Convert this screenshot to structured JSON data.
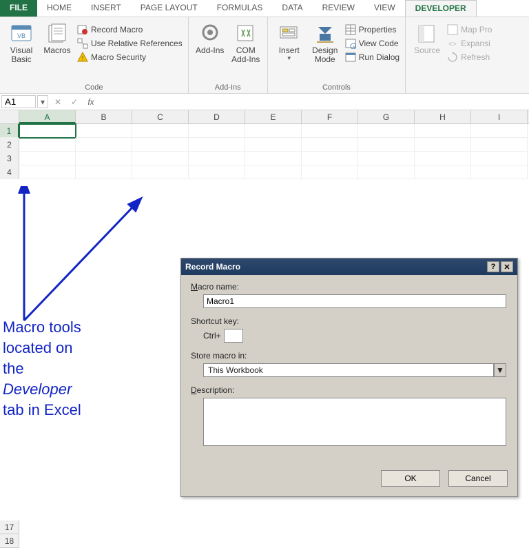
{
  "tabs": {
    "file": "FILE",
    "home": "HOME",
    "insert": "INSERT",
    "page_layout": "PAGE LAYOUT",
    "formulas": "FORMULAS",
    "data": "DATA",
    "review": "REVIEW",
    "view": "VIEW",
    "developer": "DEVELOPER"
  },
  "ribbon": {
    "code": {
      "visual_basic": "Visual\nBasic",
      "macros": "Macros",
      "record_macro": "Record Macro",
      "use_relative": "Use Relative References",
      "macro_security": "Macro Security",
      "label": "Code"
    },
    "addins": {
      "addins": "Add-Ins",
      "com_addins": "COM\nAdd-Ins",
      "label": "Add-Ins"
    },
    "controls": {
      "insert": "Insert",
      "design_mode": "Design\nMode",
      "properties": "Properties",
      "view_code": "View Code",
      "run_dialog": "Run Dialog",
      "label": "Controls"
    },
    "xml": {
      "source": "Source",
      "map_props": "Map Pro",
      "expansion": "Expansi",
      "refresh": "Refresh"
    }
  },
  "namebox": "A1",
  "columns": [
    "A",
    "B",
    "C",
    "D",
    "E",
    "F",
    "G",
    "H",
    "I"
  ],
  "rows_top": [
    "1",
    "2",
    "3",
    "4"
  ],
  "rows_bottom": [
    "17",
    "18"
  ],
  "dialog": {
    "title": "Record Macro",
    "macro_name_label_pre": "M",
    "macro_name_label_rest": "acro name:",
    "macro_name_value": "Macro1",
    "shortcut_label": "Shortcut key:",
    "shortcut_prefix": "Ctrl+",
    "shortcut_value": "",
    "store_label": "Store macro in:",
    "store_value": "This Workbook",
    "description_label_pre": "D",
    "description_label_rest": "escription:",
    "description_value": "",
    "ok": "OK",
    "cancel": "Cancel"
  },
  "annotation": {
    "l1": "Macro tools",
    "l2": "located on",
    "l3": "the",
    "l4": "Developer",
    "l5": "tab in Excel"
  }
}
